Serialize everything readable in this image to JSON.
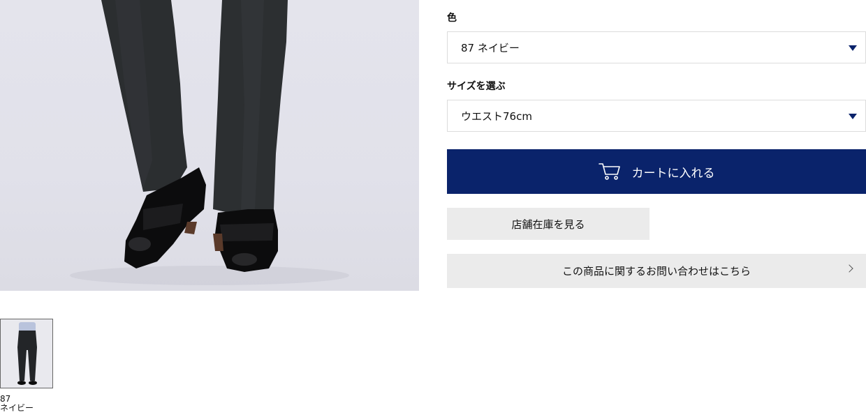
{
  "product": {
    "main_image_alt": "trousers with loafers",
    "color_label": "色",
    "color_value": "87 ネイビー",
    "size_label": "サイズを選ぶ",
    "size_value": "ウエスト76cm",
    "cart_button": "カートに入れる",
    "stock_button": "店舗在庫を見る",
    "inquiry_button": "この商品に関するお問い合わせはこちら"
  },
  "thumbnails": [
    {
      "code": "87",
      "name": "ネイビー"
    }
  ],
  "colors": {
    "accent": "#0a236b",
    "secondary_button": "#ebebeb"
  },
  "icons": {
    "cart": "cart-icon",
    "caret": "caret-down-icon",
    "chevron": "chevron-right-icon"
  }
}
